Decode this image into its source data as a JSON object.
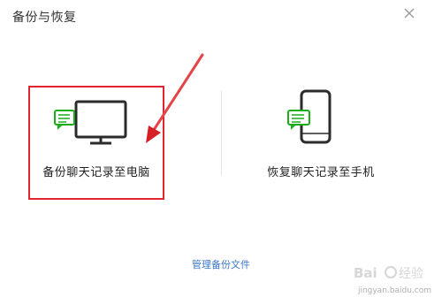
{
  "window": {
    "title": "备份与恢复",
    "close_icon": "close-icon"
  },
  "options": {
    "backup_to_pc": {
      "label": "备份聊天记录至电脑",
      "icon": "monitor-chat-icon"
    },
    "restore_to_phone": {
      "label": "恢复聊天记录至手机",
      "icon": "phone-chat-icon"
    }
  },
  "footer": {
    "manage_link": "管理备份文件"
  },
  "annotation": {
    "highlight_color": "#e0262c",
    "arrow_color": "#e0262c"
  },
  "watermark": {
    "text": "jingyan.baidu.com"
  },
  "colors": {
    "icon_green": "#1aad19",
    "icon_dark": "#2b2b2b",
    "link_blue": "#3c78c8"
  }
}
